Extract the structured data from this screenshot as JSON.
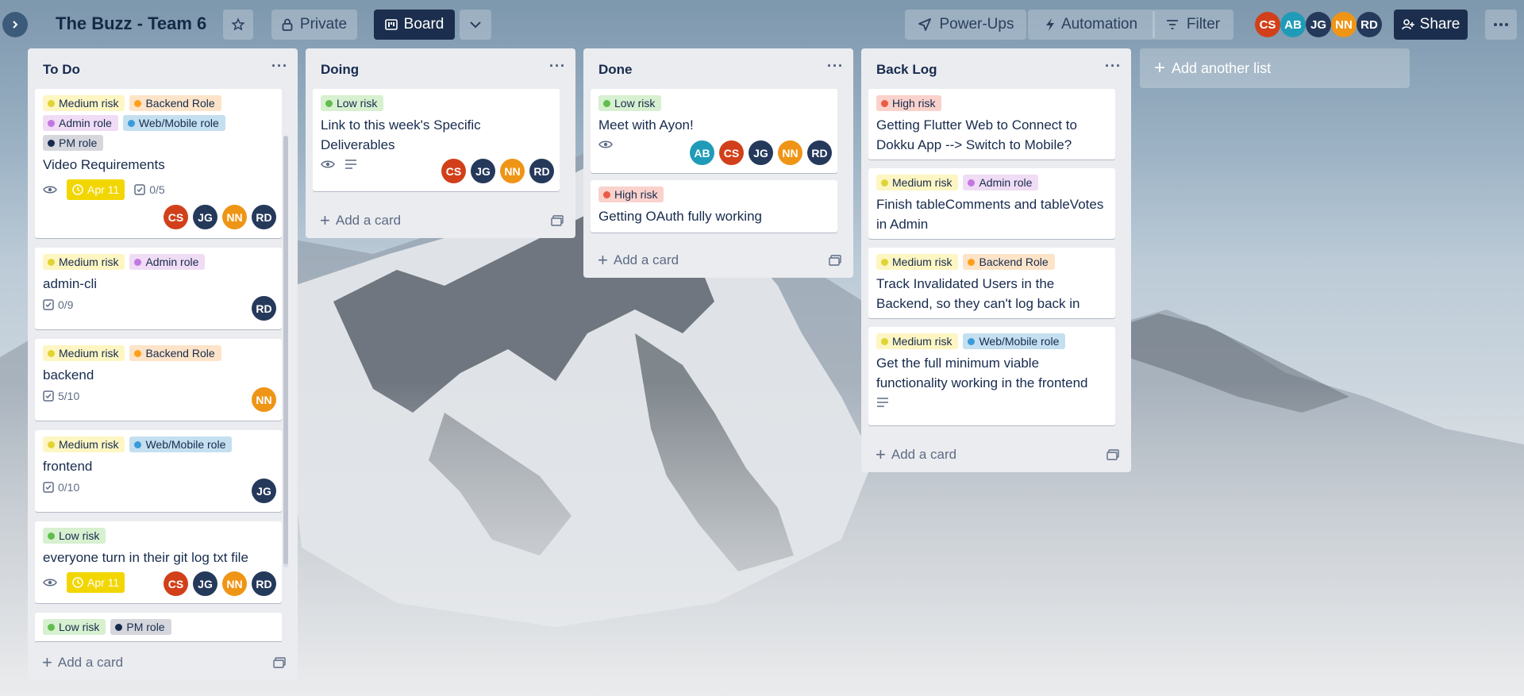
{
  "board": {
    "title": "The Buzz - Team 6",
    "visibility": "Private",
    "view": "Board",
    "power_ups": "Power-Ups",
    "automation": "Automation",
    "filter": "Filter",
    "share": "Share",
    "members": [
      {
        "initials": "CS",
        "color": "#d1401a"
      },
      {
        "initials": "AB",
        "color": "#1f9bb8"
      },
      {
        "initials": "JG",
        "color": "#25395b"
      },
      {
        "initials": "NN",
        "color": "#ef9516"
      },
      {
        "initials": "RD",
        "color": "#25395b"
      }
    ]
  },
  "add_card_label": "Add a card",
  "add_list_label": "Add another list",
  "lists": [
    {
      "title": "To Do",
      "cards": [
        {
          "labels": [
            "Medium risk",
            "Backend Role",
            "Admin role",
            "Web/Mobile role",
            "PM role"
          ],
          "title": "Video Requirements",
          "due": "Apr 11",
          "checklist": "0/5",
          "members": [
            "CS",
            "JG",
            "NN",
            "RD"
          ]
        },
        {
          "labels": [
            "Medium risk",
            "Admin role"
          ],
          "title": "admin-cli",
          "checklist": "0/9",
          "members": [
            "RD"
          ]
        },
        {
          "labels": [
            "Medium risk",
            "Backend Role"
          ],
          "title": "backend",
          "checklist": "5/10",
          "members": [
            "NN"
          ]
        },
        {
          "labels": [
            "Medium risk",
            "Web/Mobile role"
          ],
          "title": "frontend",
          "checklist": "0/10",
          "members": [
            "JG"
          ]
        },
        {
          "labels": [
            "Low risk"
          ],
          "title": "everyone turn in their git log txt file",
          "due": "Apr 11",
          "members": [
            "CS",
            "JG",
            "NN",
            "RD"
          ]
        },
        {
          "labels": [
            "Low risk",
            "PM role"
          ]
        }
      ]
    },
    {
      "title": "Doing",
      "cards": [
        {
          "labels": [
            "Low risk"
          ],
          "title": "Link to this week's Specific Deliverables",
          "members": [
            "CS",
            "JG",
            "NN",
            "RD"
          ]
        }
      ]
    },
    {
      "title": "Done",
      "cards": [
        {
          "labels": [
            "Low risk"
          ],
          "title": "Meet with Ayon!",
          "members": [
            "AB",
            "CS",
            "JG",
            "NN",
            "RD"
          ]
        },
        {
          "labels": [
            "High risk"
          ],
          "title": "Getting OAuth fully working"
        }
      ]
    },
    {
      "title": "Back Log",
      "cards": [
        {
          "labels": [
            "High risk"
          ],
          "title": "Getting Flutter Web to Connect to Dokku App --> Switch to Mobile?"
        },
        {
          "labels": [
            "Medium risk",
            "Admin role"
          ],
          "title": "Finish tableComments and tableVotes in Admin"
        },
        {
          "labels": [
            "Medium risk",
            "Backend Role"
          ],
          "title": "Track Invalidated Users in the Backend, so they can't log back in"
        },
        {
          "labels": [
            "Medium risk",
            "Web/Mobile role"
          ],
          "title": "Get the full minimum viable functionality working in the frontend"
        }
      ]
    }
  ]
}
